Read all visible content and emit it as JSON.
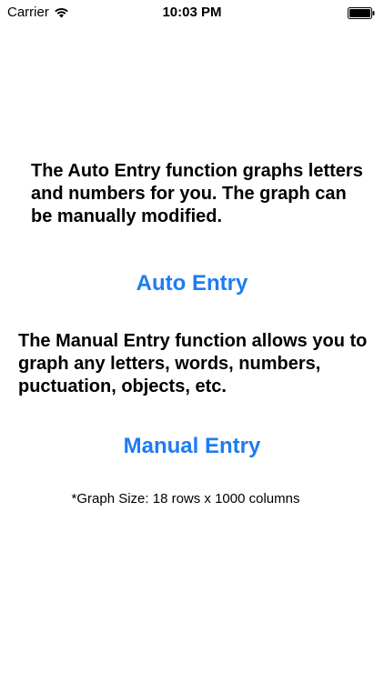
{
  "status_bar": {
    "carrier": "Carrier",
    "time": "10:03 PM",
    "icons": [
      "wifi-icon",
      "battery-icon"
    ]
  },
  "auto_section": {
    "description": "The Auto Entry function graphs letters and numbers for you. The graph can be manually modified.",
    "button_label": "Auto Entry"
  },
  "manual_section": {
    "description": "The Manual Entry function allows you to graph any letters, words, numbers, puctuation, objects, etc.",
    "button_label": "Manual Entry"
  },
  "note": "*Graph Size: 18 rows x 1000 columns",
  "colors": {
    "accent": "#1e7cf2",
    "text": "#000000",
    "background": "#ffffff"
  }
}
